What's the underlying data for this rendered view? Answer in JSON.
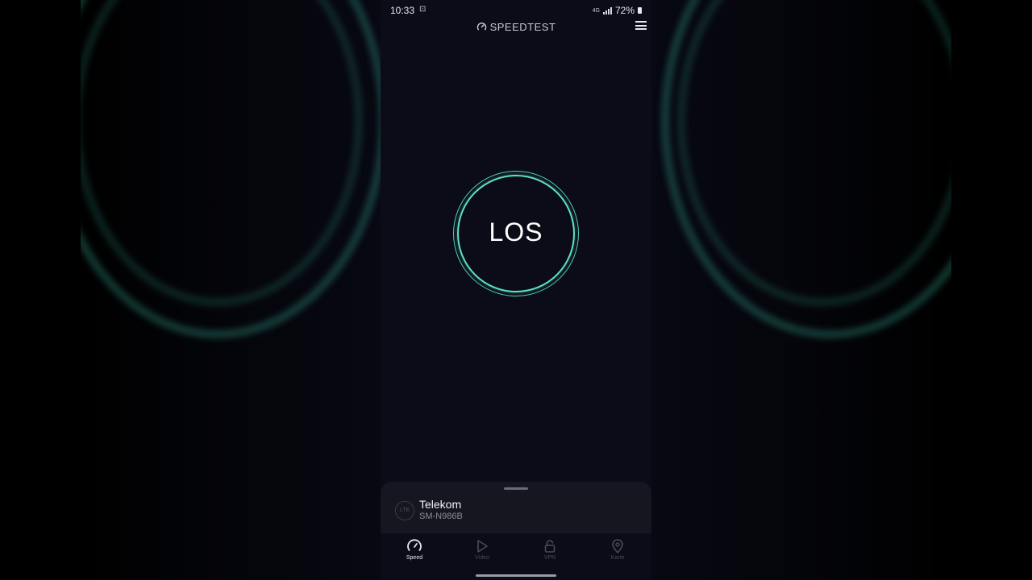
{
  "status_bar": {
    "time": "10:33",
    "network": "4G",
    "battery": "72%"
  },
  "header": {
    "brand": "SPEEDTEST"
  },
  "main": {
    "go_button_label": "LOS"
  },
  "connection": {
    "badge": "LTE",
    "provider": "Telekom",
    "device": "SM-N986B"
  },
  "tabs": [
    {
      "label": "Speed",
      "icon": "speedometer-icon",
      "active": true
    },
    {
      "label": "Video",
      "icon": "play-icon",
      "active": false
    },
    {
      "label": "VPN",
      "icon": "lock-icon",
      "active": false
    },
    {
      "label": "Karte",
      "icon": "map-pin-icon",
      "active": false
    }
  ],
  "colors": {
    "accent": "#5fe0c4",
    "background": "#0b0c17",
    "sheet": "#15161f"
  }
}
